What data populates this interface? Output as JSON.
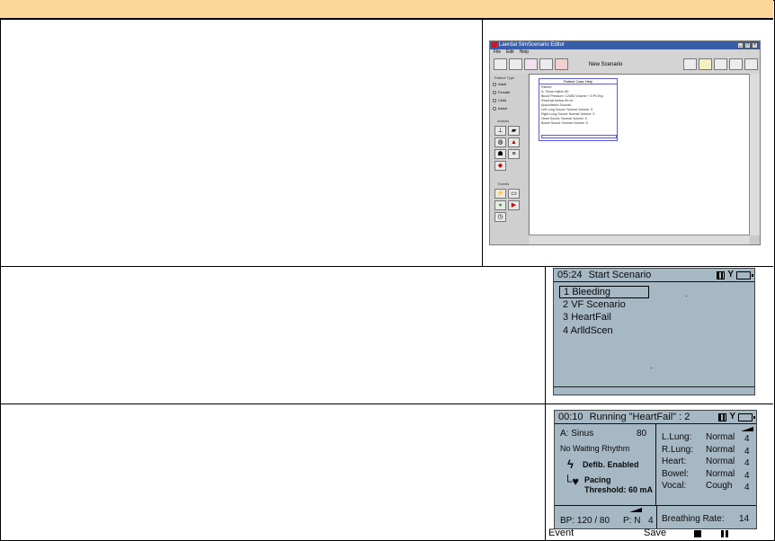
{
  "editor": {
    "title": "Laerdal SimScenario Editor",
    "menu": [
      "File",
      "Edit",
      "Help"
    ],
    "toolbar_title": "New Scenario",
    "sidebar": {
      "patient_type_label": "Patient Type",
      "patient_types": [
        "Adult",
        "Female",
        "Child",
        "Infant"
      ],
      "actions_label": "Actions",
      "events_label": "Events"
    },
    "patient_box": {
      "title": "Patient Case Help",
      "lines": [
        "Patient:",
        "A: Sinus rhythm 80",
        "Blood Pressure: 120/80  Volume + 5 Pk Exp",
        "Reversal bellow 80 ml",
        "Auscultation Sounds:",
        "Left Lung Sound: Normal  Volume: 5",
        "Right Lung Sound: Normal  Volume: 5",
        "Heart Sound: Normal  Volume: 5",
        "Bowel Sound: Normal  Volume: 5"
      ]
    }
  },
  "screen_start": {
    "time": "05:24",
    "title": "Start Scenario",
    "items": [
      {
        "num": "1",
        "label": "Bleeding"
      },
      {
        "num": "2",
        "label": "VF Scenario"
      },
      {
        "num": "3",
        "label": "HeartFail"
      },
      {
        "num": "4",
        "label": "ArlldScen"
      }
    ],
    "selected_index": 0
  },
  "screen_running": {
    "time": "00:10",
    "title": "Running \"HeartFail\" : 2",
    "rhythm_label": "A: Sinus",
    "rhythm_rate": "80",
    "waiting": "No Waiting Rhythm",
    "defib": "Defib. Enabled",
    "pacing_1": "Pacing",
    "pacing_2": "Threshold: 60 mA",
    "sounds": [
      {
        "name": "L.Lung:",
        "value": "Normal",
        "level": "4"
      },
      {
        "name": "R.Lung:",
        "value": "Normal",
        "level": "4"
      },
      {
        "name": "Heart:",
        "value": "Normal",
        "level": "4"
      },
      {
        "name": "Bowel:",
        "value": "Normal",
        "level": "4"
      },
      {
        "name": "Vocal:",
        "value": "Cough",
        "level": "4"
      }
    ],
    "bp": "BP: 120 / 80",
    "pulse": "P: N",
    "pulse_level": "4",
    "breathing": "Breathing Rate:",
    "breathing_value": "14",
    "softkeys": {
      "left": "Event",
      "middle": "Save"
    }
  }
}
